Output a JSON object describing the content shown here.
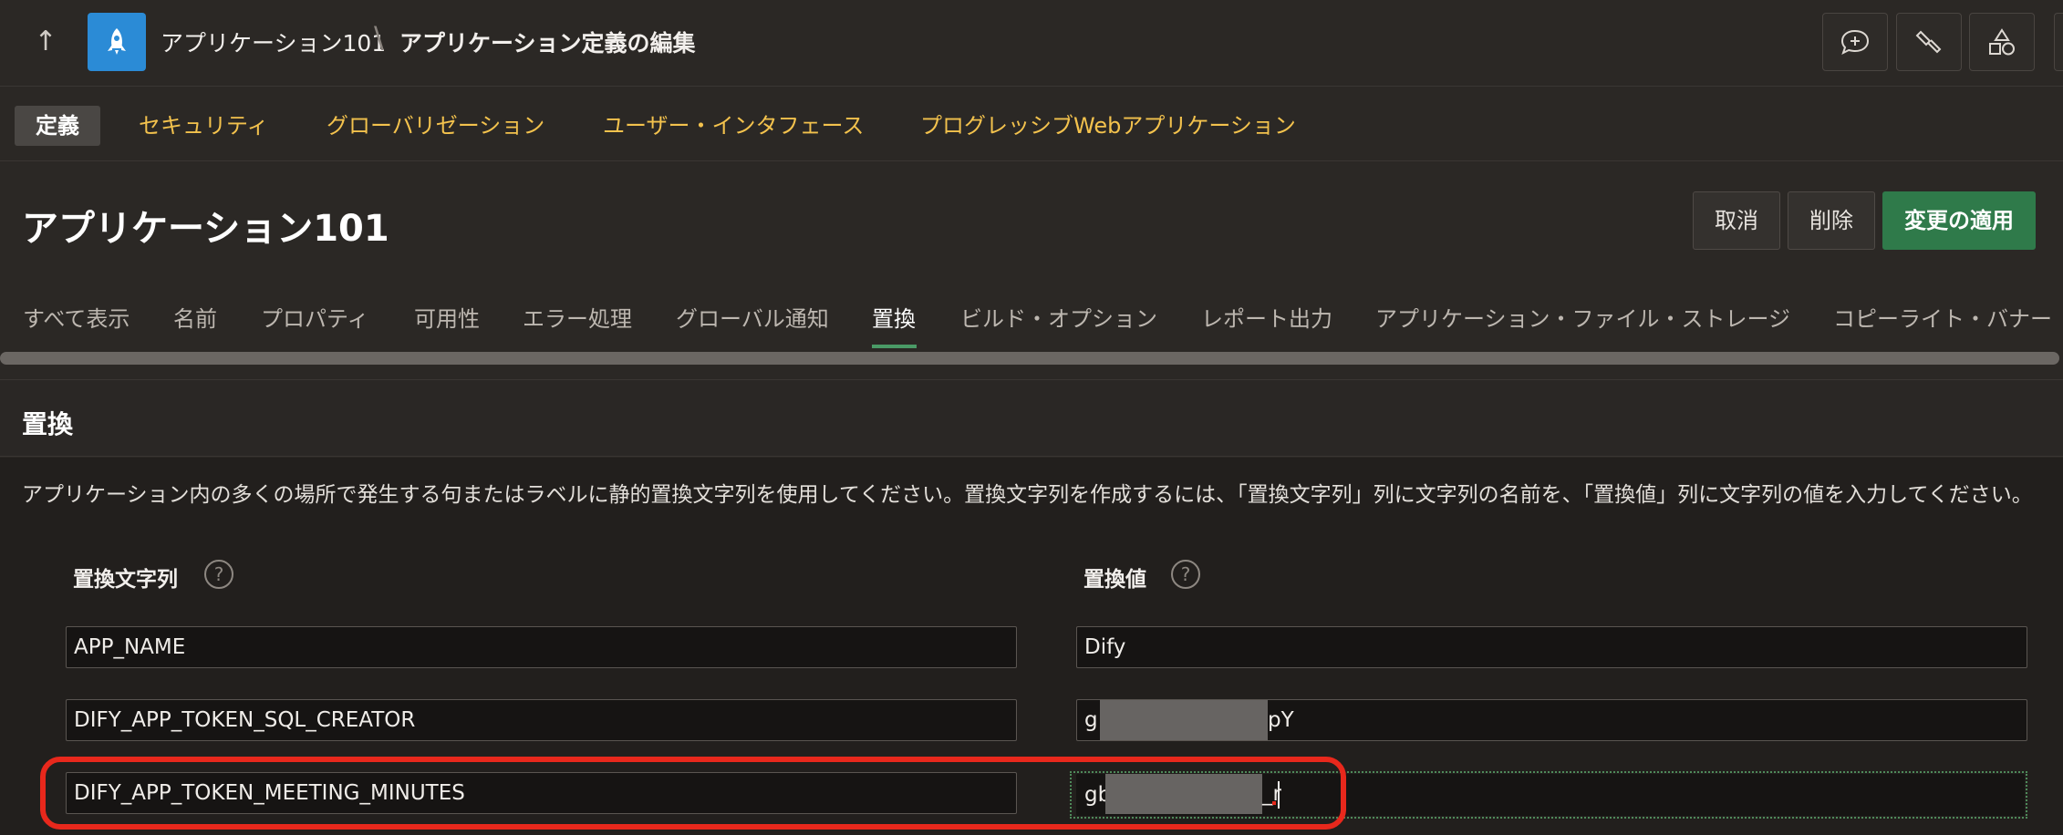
{
  "header": {
    "up_icon": "arrow-up-icon",
    "app_icon": "rocket-icon",
    "breadcrumb_app": "アプリケーション101",
    "breadcrumb_separator": "\\",
    "breadcrumb_current": "アプリケーション定義の編集",
    "tools": [
      "comment-add-icon",
      "brush-icon",
      "shapes-icon"
    ]
  },
  "nav": {
    "items": [
      {
        "label": "定義"
      },
      {
        "label": "セキュリティ"
      },
      {
        "label": "グローバリゼーション"
      },
      {
        "label": "ユーザー・インタフェース"
      },
      {
        "label": "プログレッシブWebアプリケーション"
      }
    ]
  },
  "page": {
    "title": "アプリケーション101",
    "cancel_label": "取消",
    "delete_label": "削除",
    "apply_label": "変更の適用"
  },
  "tabs": {
    "items": [
      {
        "label": "すべて表示"
      },
      {
        "label": "名前"
      },
      {
        "label": "プロパティ"
      },
      {
        "label": "可用性"
      },
      {
        "label": "エラー処理"
      },
      {
        "label": "グローバル通知"
      },
      {
        "label": "置換"
      },
      {
        "label": "ビルド・オプション"
      },
      {
        "label": "レポート出力"
      },
      {
        "label": "アプリケーション・ファイル・ストレージ"
      },
      {
        "label": "コピーライト・バナー"
      }
    ],
    "active": "置換"
  },
  "region": {
    "title": "置換",
    "description": "アプリケーション内の多くの場所で発生する句またはラベルに静的置換文字列を使用してください。置換文字列を作成するには、「置換文字列」列に文字列の名前を、「置換値」列に文字列の値を入力してください。",
    "col_string": "置換文字列",
    "col_value": "置換値",
    "help": "?",
    "rows": [
      {
        "name": "APP_NAME",
        "value": "Dify"
      },
      {
        "name": "DIFY_APP_TOKEN_SQL_CREATOR",
        "value": "g",
        "value_end": "pY"
      },
      {
        "name": "DIFY_APP_TOKEN_MEETING_MINUTES",
        "value": "gb",
        "value_end": "_r"
      }
    ]
  }
}
